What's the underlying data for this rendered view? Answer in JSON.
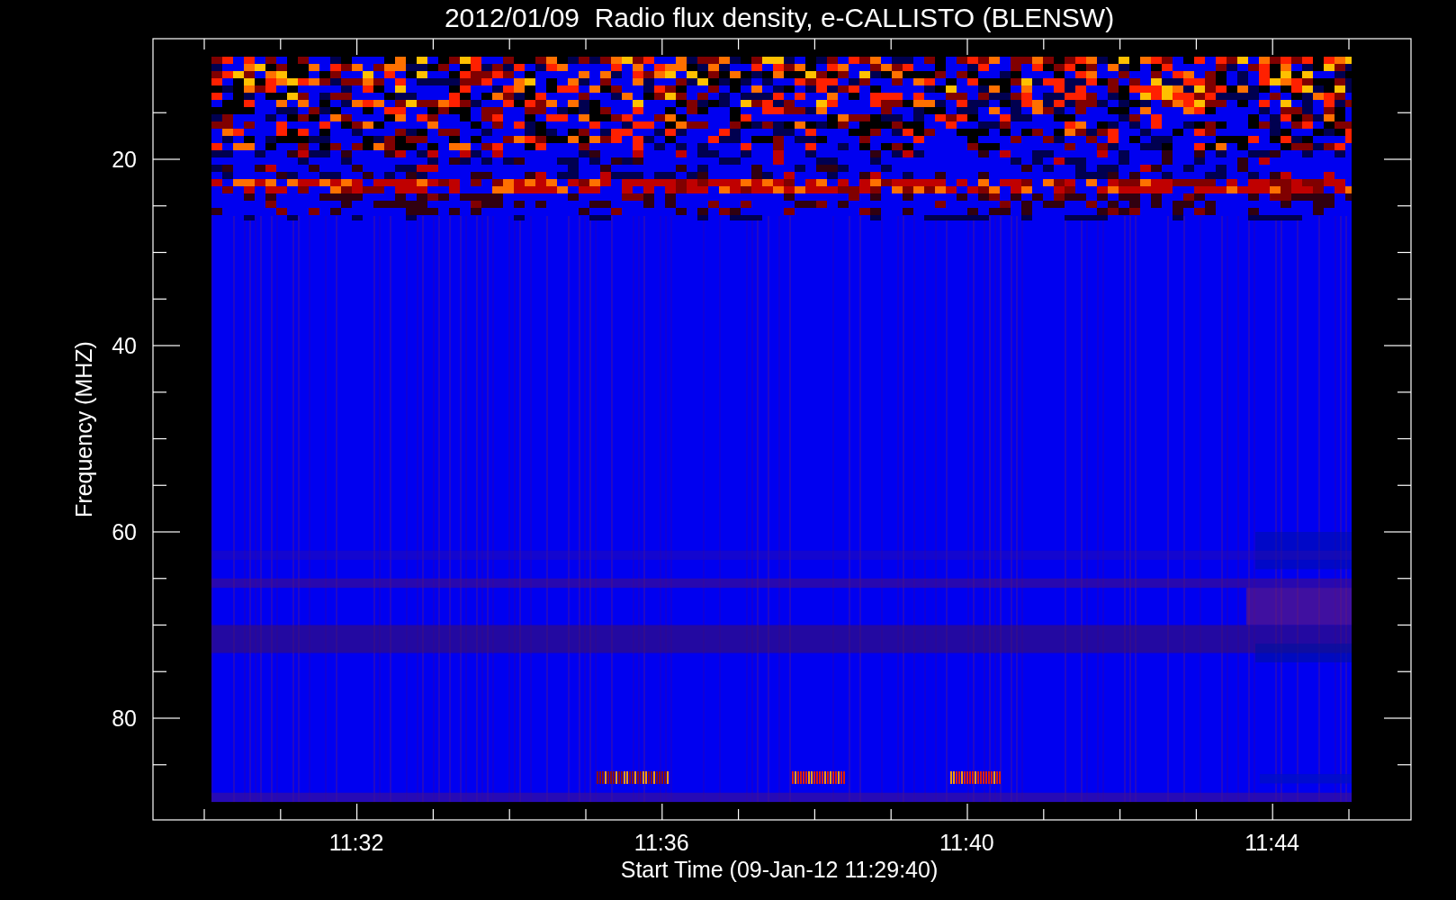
{
  "title": "2012/01/09  Radio flux density, e-CALLISTO (BLENSW)",
  "ylabel": "Frequency (MHZ)",
  "xlabel": "Start Time (09-Jan-12 11:29:40)",
  "y_tick_labels": [
    "20",
    "40",
    "60",
    "80"
  ],
  "x_tick_labels": [
    "11:32",
    "11:36",
    "11:40",
    "11:44"
  ]
}
